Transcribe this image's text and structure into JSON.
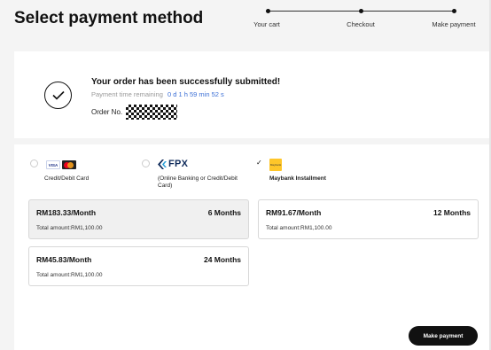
{
  "page": {
    "title": "Select payment method"
  },
  "stepper": {
    "steps": [
      "Your cart",
      "Checkout",
      "Make payment"
    ]
  },
  "status": {
    "title": "Your order has been successfully submitted!",
    "timer_label": "Payment time remaining",
    "timer_value": "0 d 1 h 59 min 52 s",
    "order_label": "Order No."
  },
  "methods": {
    "card": {
      "label": "Credit/Debit Card",
      "visa_text": "VISA"
    },
    "fpx": {
      "logo_text": "FPX",
      "label_line1": "(Online Banking or Credit/Debit",
      "label_line2": "Card)"
    },
    "maybank": {
      "label": "Maybank Installment",
      "check": "✓",
      "logo_text": "Maybank"
    }
  },
  "plans": [
    {
      "monthly": "RM183.33/Month",
      "term": "6 Months",
      "total": "Total amount:RM1,100.00"
    },
    {
      "monthly": "RM91.67/Month",
      "term": "12 Months",
      "total": "Total amount:RM1,100.00"
    },
    {
      "monthly": "RM45.83/Month",
      "term": "24 Months",
      "total": "Total amount:RM1,100.00"
    }
  ],
  "actions": {
    "make_payment": "Make payment"
  },
  "colors": {
    "accent_link": "#3b6fd6",
    "button_bg": "#111111",
    "maybank_yellow": "#ffc629"
  }
}
